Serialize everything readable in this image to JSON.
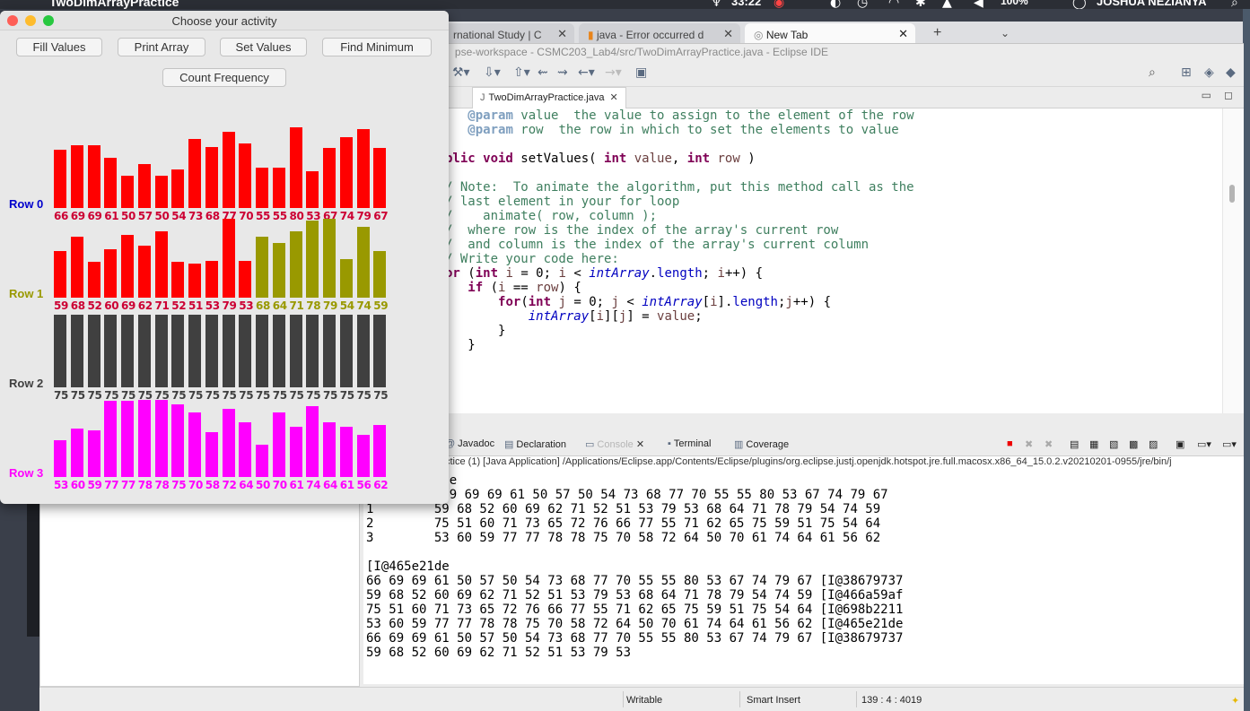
{
  "menubar": {
    "app_title": "TwoDimArrayPractice",
    "clock": "33:22",
    "battery": "100%",
    "user": "JOSHUA NEZIANYA"
  },
  "browser": {
    "tabs": [
      {
        "label": "rnational Study | C"
      },
      {
        "label": "java - Error occurred d"
      },
      {
        "label": "New Tab"
      }
    ],
    "new_tab": "+"
  },
  "eclipse": {
    "title": "pse-workspace - CSMC203_Lab4/src/TwoDimArrayPractice.java - Eclipse IDE",
    "editor_tab": "TwoDimArrayPractice.java",
    "code_lines": [
      "   @param value  the value to assign to the element of the row",
      "   @param row  the row in which to set the elements to value",
      "",
      "blic void setValues( int value, int row )",
      "",
      "/ Note:  To animate the algorithm, put this method call as the",
      "/ last element in your for loop",
      "/    animate( row, column );",
      "/  where row is the index of the array's current row",
      "/  and column is the index of the array's current column",
      "/ Write your code here:",
      "or (int i = 0; i < intArray.length; i++) {",
      "   if (i == row) {",
      "       for(int j = 0; j < intArray[i].length;j++) {",
      "           intArray[i][j] = value;",
      "       }",
      "   }"
    ],
    "console_tabs": [
      "Javadoc",
      "Declaration",
      "Console",
      "Terminal",
      "Coverage"
    ],
    "console_path": "ctice (1) [Java Application] /Applications/Eclipse.app/Contents/Eclipse/plugins/org.eclipse.justj.openjdk.hotspot.jre.full.macosx.x86_64_15.0.2.v20210201-0955/jre/bin/j",
    "console_lines": [
      "          ue",
      "          69 69 69 61 50 57 50 54 73 68 77 70 55 55 80 53 67 74 79 67",
      "1        59 68 52 60 69 62 71 52 51 53 79 53 68 64 71 78 79 54 74 59",
      "2        75 51 60 71 73 65 72 76 66 77 55 71 62 65 75 59 51 75 54 64",
      "3        53 60 59 77 77 78 78 75 70 58 72 64 50 70 61 74 64 61 56 62",
      "",
      "[I@465e21de",
      "66 69 69 61 50 57 50 54 73 68 77 70 55 55 80 53 67 74 79 67 [I@38679737",
      "59 68 52 60 69 62 71 52 51 53 79 53 68 64 71 78 79 54 74 59 [I@466a59af",
      "75 51 60 71 73 65 72 76 66 77 55 71 62 65 75 59 51 75 54 64 [I@698b2211",
      "53 60 59 77 77 78 78 75 70 58 72 64 50 70 61 74 64 61 56 62 [I@465e21de",
      "66 69 69 61 50 57 50 54 73 68 77 70 55 55 80 53 67 74 79 67 [I@38679737",
      "59 68 52 60 69 62 71 52 51 53 79 53"
    ],
    "status": {
      "writable": "Writable",
      "insert_mode": "Smart Insert",
      "position": "139 : 4 : 4019"
    }
  },
  "app": {
    "title": "Choose your activity",
    "buttons": {
      "fill": "Fill Values",
      "print": "Print Array",
      "set": "Set Values",
      "find": "Find Minimum",
      "count": "Count Frequency"
    },
    "colors": {
      "red": "#ff0000",
      "olive": "#999900",
      "gray": "#404040",
      "magenta": "#ff00ff",
      "label_red": "#cc0033",
      "label_blue": "#0000cc"
    },
    "rows": [
      {
        "label": "Row 0",
        "label_color": "#0000cc",
        "values": [
          66,
          69,
          69,
          61,
          50,
          57,
          50,
          54,
          73,
          68,
          77,
          70,
          55,
          55,
          80,
          53,
          67,
          74,
          79,
          67
        ],
        "colors": [
          "red",
          "red",
          "red",
          "red",
          "red",
          "red",
          "red",
          "red",
          "red",
          "red",
          "red",
          "red",
          "red",
          "red",
          "red",
          "red",
          "red",
          "red",
          "red",
          "red"
        ]
      },
      {
        "label": "Row 1",
        "label_color": "#999900",
        "values": [
          59,
          68,
          52,
          60,
          69,
          62,
          71,
          52,
          51,
          53,
          79,
          53,
          68,
          64,
          71,
          78,
          79,
          54,
          74,
          59
        ],
        "colors": [
          "red",
          "red",
          "red",
          "red",
          "red",
          "red",
          "red",
          "red",
          "red",
          "red",
          "red",
          "red",
          "olive",
          "olive",
          "olive",
          "olive",
          "olive",
          "olive",
          "olive",
          "olive"
        ]
      },
      {
        "label": "Row 2",
        "label_color": "#404040",
        "values": [
          75,
          75,
          75,
          75,
          75,
          75,
          75,
          75,
          75,
          75,
          75,
          75,
          75,
          75,
          75,
          75,
          75,
          75,
          75,
          75
        ],
        "colors": [
          "gray",
          "gray",
          "gray",
          "gray",
          "gray",
          "gray",
          "gray",
          "gray",
          "gray",
          "gray",
          "gray",
          "gray",
          "gray",
          "gray",
          "gray",
          "gray",
          "gray",
          "gray",
          "gray",
          "gray"
        ]
      },
      {
        "label": "Row 3",
        "label_color": "#ff00ff",
        "values": [
          53,
          60,
          59,
          77,
          77,
          78,
          78,
          75,
          70,
          58,
          72,
          64,
          50,
          70,
          61,
          74,
          64,
          61,
          56,
          62
        ],
        "colors": [
          "magenta",
          "magenta",
          "magenta",
          "magenta",
          "magenta",
          "magenta",
          "magenta",
          "magenta",
          "magenta",
          "magenta",
          "magenta",
          "magenta",
          "magenta",
          "magenta",
          "magenta",
          "magenta",
          "magenta",
          "magenta",
          "magenta",
          "magenta"
        ]
      }
    ]
  }
}
